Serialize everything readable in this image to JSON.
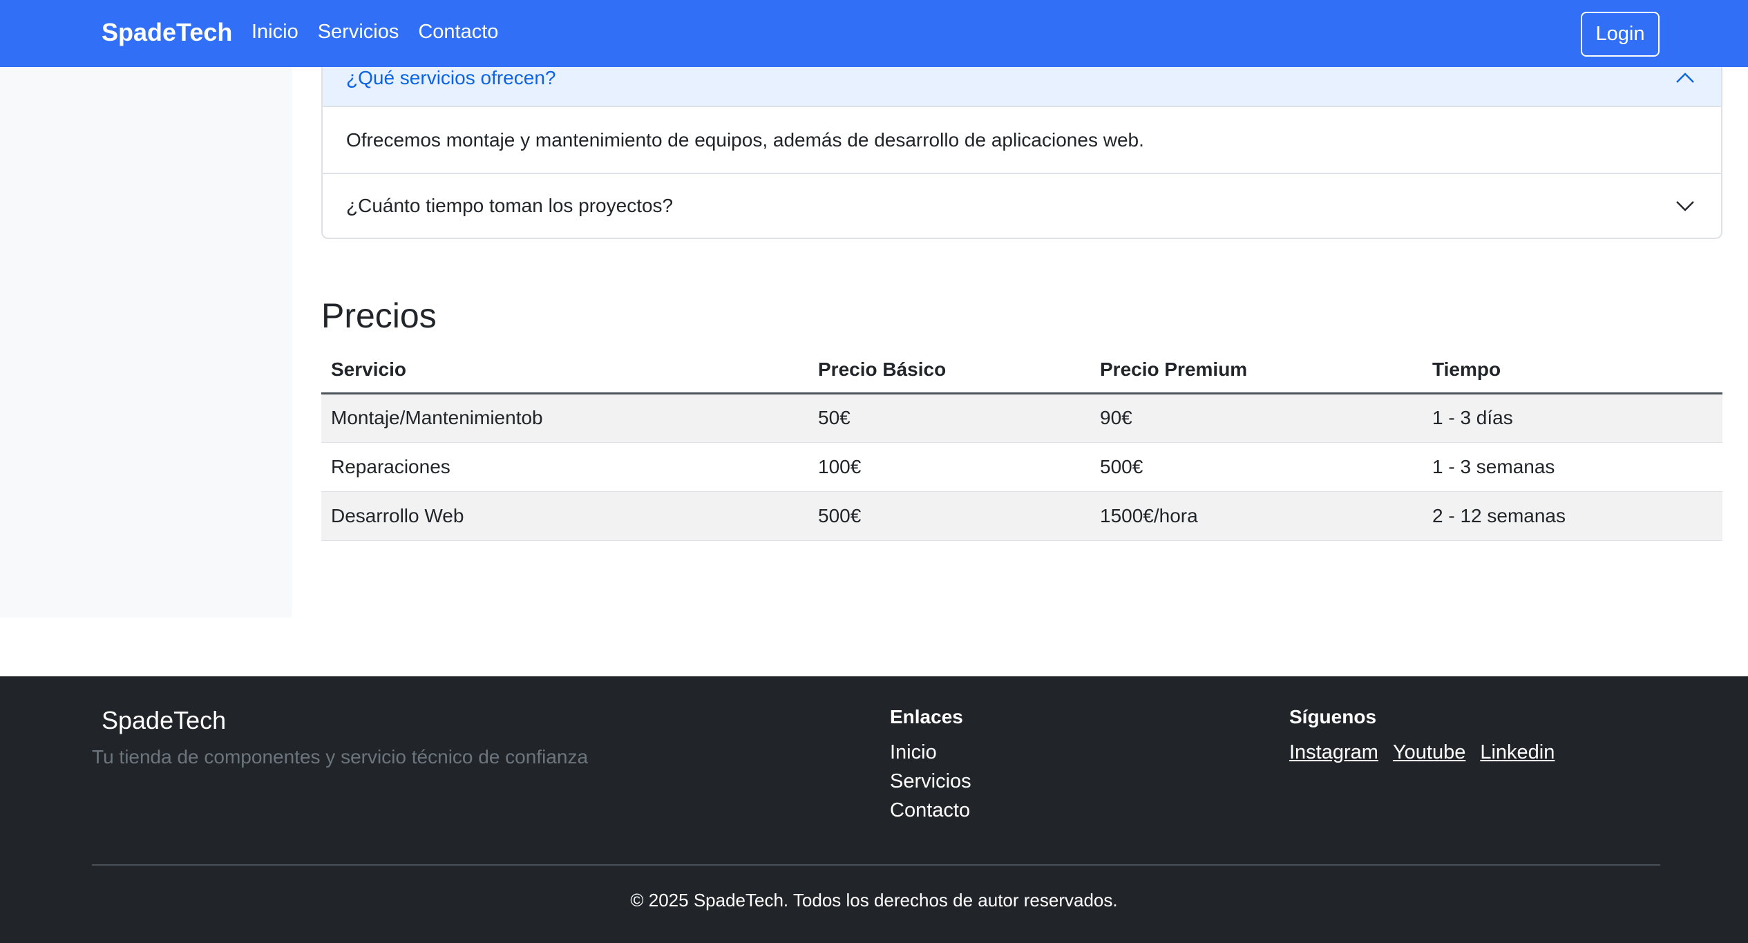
{
  "navbar": {
    "brand": "SpadeTech",
    "links": [
      "Inicio",
      "Servicios",
      "Contacto"
    ],
    "login_label": "Login",
    "color": "#316ff6"
  },
  "faq": {
    "items": [
      {
        "question": "¿Qué servicios ofrecen?",
        "answer": "Ofrecemos montaje y mantenimiento de equipos, además de desarrollo de aplicaciones web.",
        "expanded": true
      },
      {
        "question": "¿Cuánto tiempo toman los proyectos?",
        "expanded": false
      }
    ]
  },
  "pricing": {
    "title": "Precios",
    "headers": [
      "Servicio",
      "Precio Básico",
      "Precio Premium",
      "Tiempo"
    ],
    "rows": [
      [
        "Montaje/Mantenimientob",
        "50€",
        "90€",
        "1 - 3 días"
      ],
      [
        "Reparaciones",
        "100€",
        "500€",
        "1 - 3 semanas"
      ],
      [
        "Desarrollo Web",
        "500€",
        "1500€/hora",
        "2 - 12 semanas"
      ]
    ]
  },
  "footer": {
    "brand": "SpadeTech",
    "tagline": "Tu tienda de componentes y servicio técnico de confianza",
    "links_title": "Enlaces",
    "links": [
      "Inicio",
      "Servicios",
      "Contacto"
    ],
    "social_title": "Síguenos",
    "social": [
      "Instagram",
      "Youtube",
      "Linkedin"
    ],
    "copyright": "© 2025 SpadeTech. Todos los derechos de autor reservados.",
    "bg_color": "#212529"
  }
}
